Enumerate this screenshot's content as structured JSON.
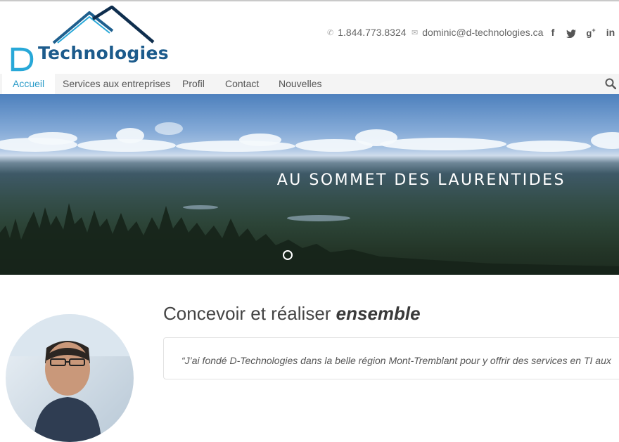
{
  "brand": {
    "logo_letter": "D",
    "logo_text": "Technologies"
  },
  "header": {
    "phone": "1.844.773.8324",
    "email": "dominic@d-technologies.ca",
    "social": [
      "facebook",
      "twitter",
      "google-plus",
      "linkedin"
    ]
  },
  "nav": {
    "items": [
      "Accueil",
      "Services aux entreprises",
      "Profil",
      "Contact",
      "Nouvelles"
    ],
    "active": "Accueil"
  },
  "hero": {
    "caption": "AU SOMMET DES LAURENTIDES"
  },
  "intro": {
    "title_plain": "Concevoir et réaliser ",
    "title_emphasis": "ensemble",
    "quote": "“J’ai fondé D-Technologies dans la belle région Mont-Tremblant pour y offrir des services en TI aux"
  },
  "colors": {
    "accent": "#2a9bc8",
    "logo_blue": "#1c5b8c",
    "logo_cyan": "#28a8d8"
  },
  "icons": {
    "phone": "phone-icon",
    "email": "envelope-icon",
    "search": "search-icon",
    "facebook": "facebook-icon",
    "twitter": "twitter-icon",
    "google_plus": "google-plus-icon",
    "linkedin": "linkedin-icon"
  }
}
